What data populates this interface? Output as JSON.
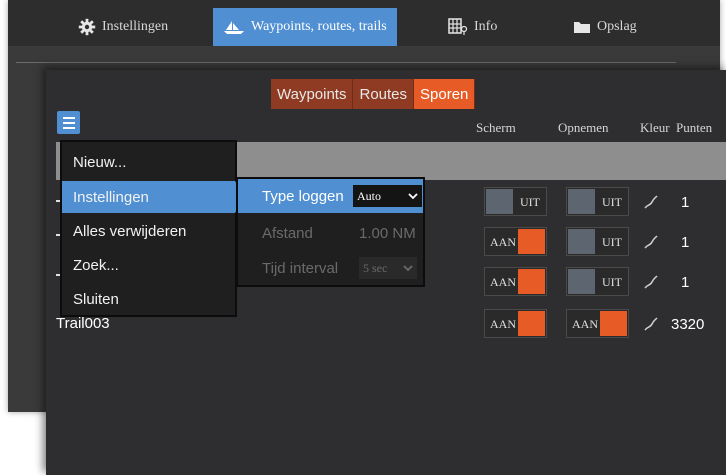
{
  "top_tabs": [
    {
      "label": "Instellingen",
      "icon": "gear-icon"
    },
    {
      "label": "Waypoints, routes, trails",
      "icon": "boat-icon"
    },
    {
      "label": "Info",
      "icon": "info-icon"
    },
    {
      "label": "Opslag",
      "icon": "folder-icon"
    }
  ],
  "sub_tabs": [
    "Waypoints",
    "Routes",
    "Sporen"
  ],
  "columns": {
    "screen": "Scherm",
    "record": "Opnemen",
    "color": "Kleur",
    "points": "Punten"
  },
  "main_menu": [
    "Nieuw...",
    "Instellingen",
    "Alles verwijderen",
    "Zoek...",
    "Sluiten"
  ],
  "sub_menu": {
    "log_type_label": "Type loggen",
    "log_type_value": "Auto",
    "distance_label": "Afstand",
    "distance_value": "1.00 NM",
    "interval_label": "Tijd interval",
    "interval_value": "5 sec"
  },
  "rows": [
    {
      "name": "",
      "screen": "UIT",
      "screen_on": false,
      "record": "UIT",
      "record_on": false,
      "points": "1"
    },
    {
      "name": "",
      "screen": "AAN",
      "screen_on": true,
      "record": "UIT",
      "record_on": false,
      "points": "1"
    },
    {
      "name": "",
      "screen": "AAN",
      "screen_on": true,
      "record": "UIT",
      "record_on": false,
      "points": "1"
    },
    {
      "name": "Trail003",
      "screen": "AAN",
      "screen_on": true,
      "record": "AAN",
      "record_on": true,
      "points": "3320"
    }
  ],
  "colors": {
    "accent_blue": "#4f8fd2",
    "accent_orange": "#e75c26"
  }
}
